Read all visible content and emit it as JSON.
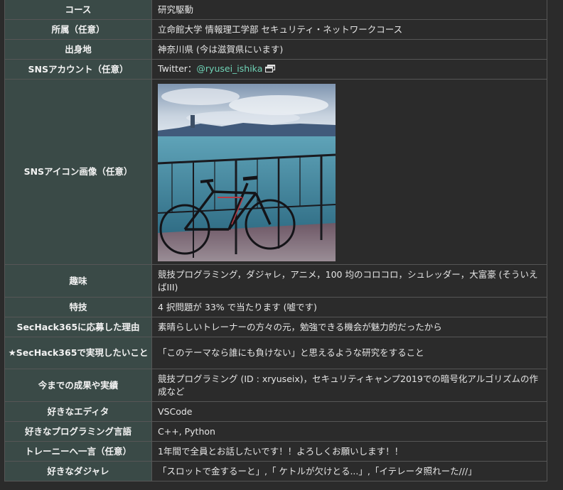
{
  "rows": [
    {
      "key": "course",
      "label": "コース",
      "value": "研究駆動"
    },
    {
      "key": "affiliation",
      "label": "所属（任意）",
      "value": "立命館大学 情報理工学部 セキュリティ・ネットワークコース"
    },
    {
      "key": "hometown",
      "label": "出身地",
      "value": "神奈川県 (今は滋賀県にいます)"
    },
    {
      "key": "sns",
      "label": "SNSアカウント（任意）",
      "prefix": "Twitter：",
      "link_text": "@ryusei_ishika",
      "link_icon": "external-link-icon"
    },
    {
      "key": "sns-icon",
      "label": "SNSアイコン画像（任意）",
      "image": "bicycle-lake-photo"
    },
    {
      "key": "hobby",
      "label": "趣味",
      "value": "競技プログラミング，ダジャレ，アニメ，100 均のコロコロ，シュレッダー，大富豪 (そういえばIII)"
    },
    {
      "key": "skill",
      "label": "特技",
      "value": "4 択問題が 33% で当たります (嘘です)"
    },
    {
      "key": "reason",
      "label": "SecHack365に応募した理由",
      "value": "素晴らしいトレーナーの方々の元，勉強できる機会が魅力的だったから"
    },
    {
      "key": "goal",
      "label": "★SecHack365で実現したいこと",
      "value": "「このテーマなら誰にも負けない」と思えるような研究をすること"
    },
    {
      "key": "achievements",
      "label": "今までの成果や実績",
      "value": "競技プログラミング (ID : xryuseix)，セキュリティキャンプ2019での暗号化アルゴリズムの作成など"
    },
    {
      "key": "editor",
      "label": "好きなエディタ",
      "value": "VSCode"
    },
    {
      "key": "language",
      "label": "好きなプログラミング言語",
      "value": "C++, Python"
    },
    {
      "key": "message",
      "label": "トレーニーへ一言（任意）",
      "value": "1年間で全員とお話したいです！！よろしくお願いします！！"
    },
    {
      "key": "pun",
      "label": "好きなダジャレ",
      "value": "「スロットで金するーと」,「 ケトルが欠けとる...」,「イテレータ照れーた///」"
    }
  ],
  "colors": {
    "label_bg": "#3a4a47",
    "page_bg": "#2b2b2b",
    "border": "#565656",
    "link": "#6fd3b6"
  }
}
